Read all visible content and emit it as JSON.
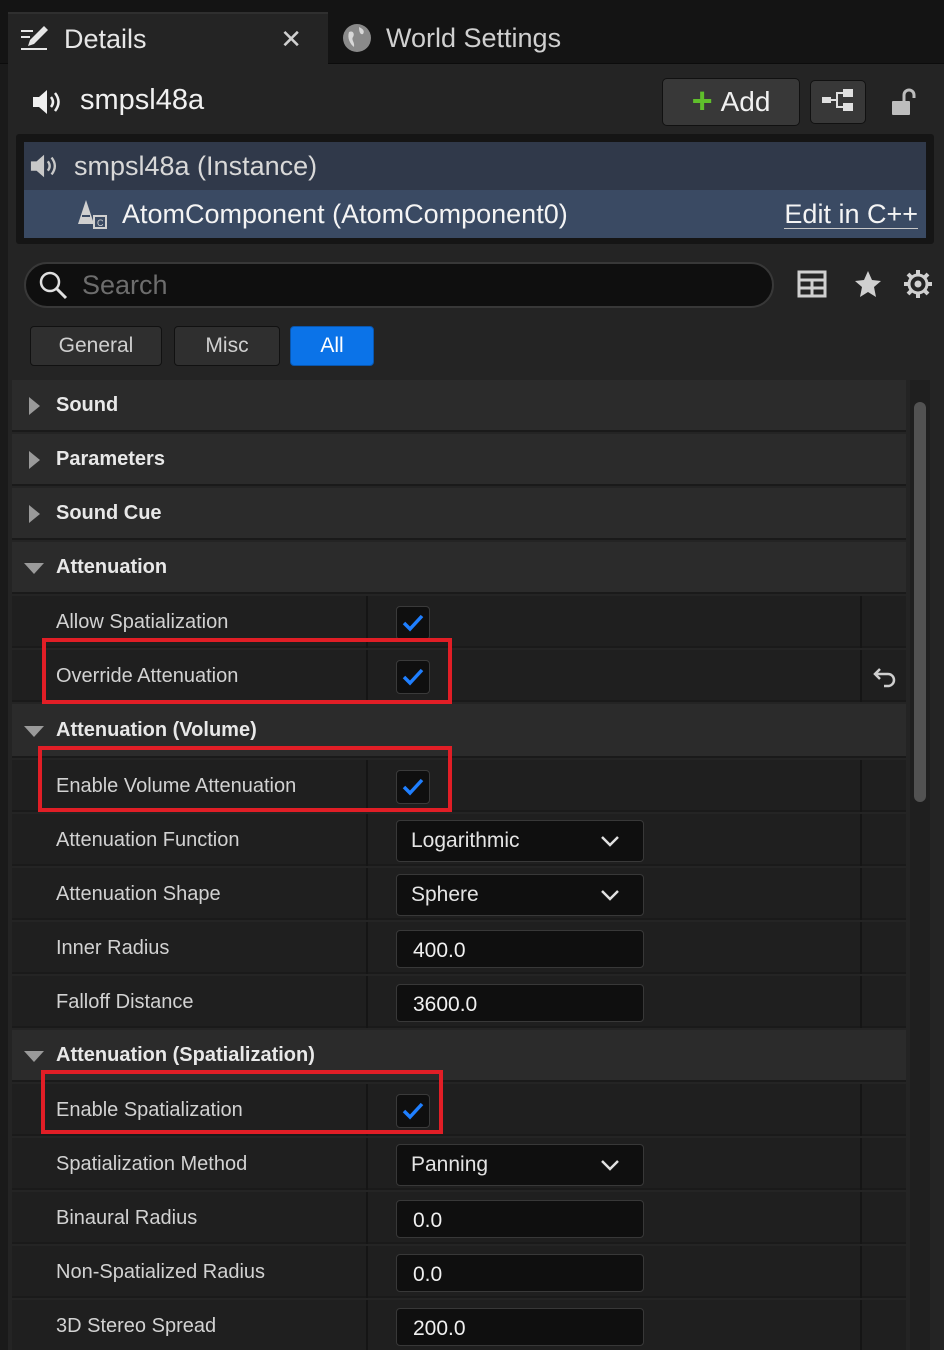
{
  "tabs": [
    {
      "label": "Details",
      "icon": "details-pencil-icon",
      "active": true
    },
    {
      "label": "World Settings",
      "icon": "globe-icon",
      "active": false
    }
  ],
  "header": {
    "title": "smpsl48a",
    "icon": "speaker-icon",
    "add_label": "Add"
  },
  "tree": {
    "instance_label": "smpsl48a (Instance)",
    "component_label": "AtomComponent (AtomComponent0)",
    "edit_link": "Edit in C++"
  },
  "search": {
    "placeholder": "Search"
  },
  "filters": [
    "General",
    "Misc",
    "All"
  ],
  "active_filter": "All",
  "colors": {
    "accent": "#0b73e8",
    "highlight": "#e11e26",
    "add_plus": "#5fbf2b",
    "selected_row": "#3a4a63"
  },
  "categories": {
    "sound": "Sound",
    "parameters": "Parameters",
    "sound_cue": "Sound Cue",
    "attenuation": "Attenuation",
    "attenuation_volume": "Attenuation (Volume)",
    "attenuation_spatialization": "Attenuation (Spatialization)"
  },
  "properties": {
    "allow_spatialization": {
      "label": "Allow Spatialization",
      "checked": true
    },
    "override_attenuation": {
      "label": "Override Attenuation",
      "checked": true
    },
    "enable_volume_attenuation": {
      "label": "Enable Volume Attenuation",
      "checked": true
    },
    "attenuation_function": {
      "label": "Attenuation Function",
      "value": "Logarithmic"
    },
    "attenuation_shape": {
      "label": "Attenuation Shape",
      "value": "Sphere"
    },
    "inner_radius": {
      "label": "Inner Radius",
      "value": "400.0"
    },
    "falloff_distance": {
      "label": "Falloff Distance",
      "value": "3600.0"
    },
    "enable_spatialization": {
      "label": "Enable Spatialization",
      "checked": true
    },
    "spatialization_method": {
      "label": "Spatialization Method",
      "value": "Panning"
    },
    "binaural_radius": {
      "label": "Binaural Radius",
      "value": "0.0"
    },
    "non_spatialized_radius": {
      "label": "Non-Spatialized Radius",
      "value": "0.0"
    },
    "stereo_spread": {
      "label": "3D Stereo Spread",
      "value": "200.0"
    }
  }
}
